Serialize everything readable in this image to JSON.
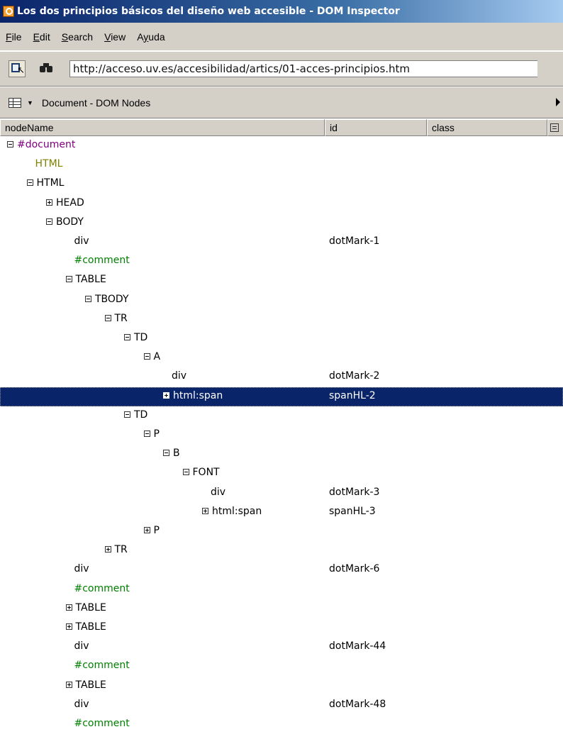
{
  "window": {
    "title": "Los dos principios básicos del diseño web accesible - DOM Inspector",
    "icon": "dom-inspector-app-icon"
  },
  "menu": [
    {
      "label": "File",
      "accesskey": "F"
    },
    {
      "label": "Edit",
      "accesskey": "E"
    },
    {
      "label": "Search",
      "accesskey": "S"
    },
    {
      "label": "View",
      "accesskey": "V"
    },
    {
      "label": "Ayuda",
      "accesskey": "y"
    }
  ],
  "toolbar": {
    "inspect_icon": "inspect-element-icon",
    "find_icon": "binoculars-icon",
    "url": "http://acceso.uv.es/accesibilidad/artics/01-acces-principios.htm"
  },
  "panel": {
    "viewer_icon": "viewer-list-icon",
    "title": "Document - DOM Nodes"
  },
  "columns": {
    "nodeName": "nodeName",
    "id": "id",
    "class": "class"
  },
  "tree": [
    {
      "depth": 0,
      "toggle": "minus",
      "name": "#document",
      "id": "",
      "style": "purple"
    },
    {
      "depth": 1,
      "toggle": "none",
      "name": "HTML",
      "id": "",
      "style": "olive"
    },
    {
      "depth": 1,
      "toggle": "minus",
      "name": "HTML",
      "id": "",
      "style": "normal"
    },
    {
      "depth": 2,
      "toggle": "plus",
      "name": "HEAD",
      "id": "",
      "style": "normal"
    },
    {
      "depth": 2,
      "toggle": "minus",
      "name": "BODY",
      "id": "",
      "style": "normal"
    },
    {
      "depth": 3,
      "toggle": "none",
      "name": "div",
      "id": "dotMark-1",
      "style": "normal"
    },
    {
      "depth": 3,
      "toggle": "none",
      "name": "#comment",
      "id": "",
      "style": "green"
    },
    {
      "depth": 3,
      "toggle": "minus",
      "name": "TABLE",
      "id": "",
      "style": "normal"
    },
    {
      "depth": 4,
      "toggle": "minus",
      "name": "TBODY",
      "id": "",
      "style": "normal"
    },
    {
      "depth": 5,
      "toggle": "minus",
      "name": "TR",
      "id": "",
      "style": "normal"
    },
    {
      "depth": 6,
      "toggle": "minus",
      "name": "TD",
      "id": "",
      "style": "normal"
    },
    {
      "depth": 7,
      "toggle": "minus",
      "name": "A",
      "id": "",
      "style": "normal"
    },
    {
      "depth": 8,
      "toggle": "none",
      "name": "div",
      "id": "dotMark-2",
      "style": "normal"
    },
    {
      "depth": 8,
      "toggle": "plus",
      "name": "html:span",
      "id": "spanHL-2",
      "style": "normal",
      "selected": true
    },
    {
      "depth": 6,
      "toggle": "minus",
      "name": "TD",
      "id": "",
      "style": "normal"
    },
    {
      "depth": 7,
      "toggle": "minus",
      "name": "P",
      "id": "",
      "style": "normal"
    },
    {
      "depth": 8,
      "toggle": "minus",
      "name": "B",
      "id": "",
      "style": "normal"
    },
    {
      "depth": 9,
      "toggle": "minus",
      "name": "FONT",
      "id": "",
      "style": "normal"
    },
    {
      "depth": 10,
      "toggle": "none",
      "name": "div",
      "id": "dotMark-3",
      "style": "normal"
    },
    {
      "depth": 10,
      "toggle": "plus",
      "name": "html:span",
      "id": "spanHL-3",
      "style": "normal"
    },
    {
      "depth": 7,
      "toggle": "plus",
      "name": "P",
      "id": "",
      "style": "normal"
    },
    {
      "depth": 5,
      "toggle": "plus",
      "name": "TR",
      "id": "",
      "style": "normal"
    },
    {
      "depth": 3,
      "toggle": "none",
      "name": "div",
      "id": "dotMark-6",
      "style": "normal"
    },
    {
      "depth": 3,
      "toggle": "none",
      "name": "#comment",
      "id": "",
      "style": "green"
    },
    {
      "depth": 3,
      "toggle": "plus",
      "name": "TABLE",
      "id": "",
      "style": "normal"
    },
    {
      "depth": 3,
      "toggle": "plus",
      "name": "TABLE",
      "id": "",
      "style": "normal"
    },
    {
      "depth": 3,
      "toggle": "none",
      "name": "div",
      "id": "dotMark-44",
      "style": "normal"
    },
    {
      "depth": 3,
      "toggle": "none",
      "name": "#comment",
      "id": "",
      "style": "green"
    },
    {
      "depth": 3,
      "toggle": "plus",
      "name": "TABLE",
      "id": "",
      "style": "normal"
    },
    {
      "depth": 3,
      "toggle": "none",
      "name": "div",
      "id": "dotMark-48",
      "style": "normal"
    },
    {
      "depth": 3,
      "toggle": "none",
      "name": "#comment",
      "id": "",
      "style": "green"
    }
  ]
}
